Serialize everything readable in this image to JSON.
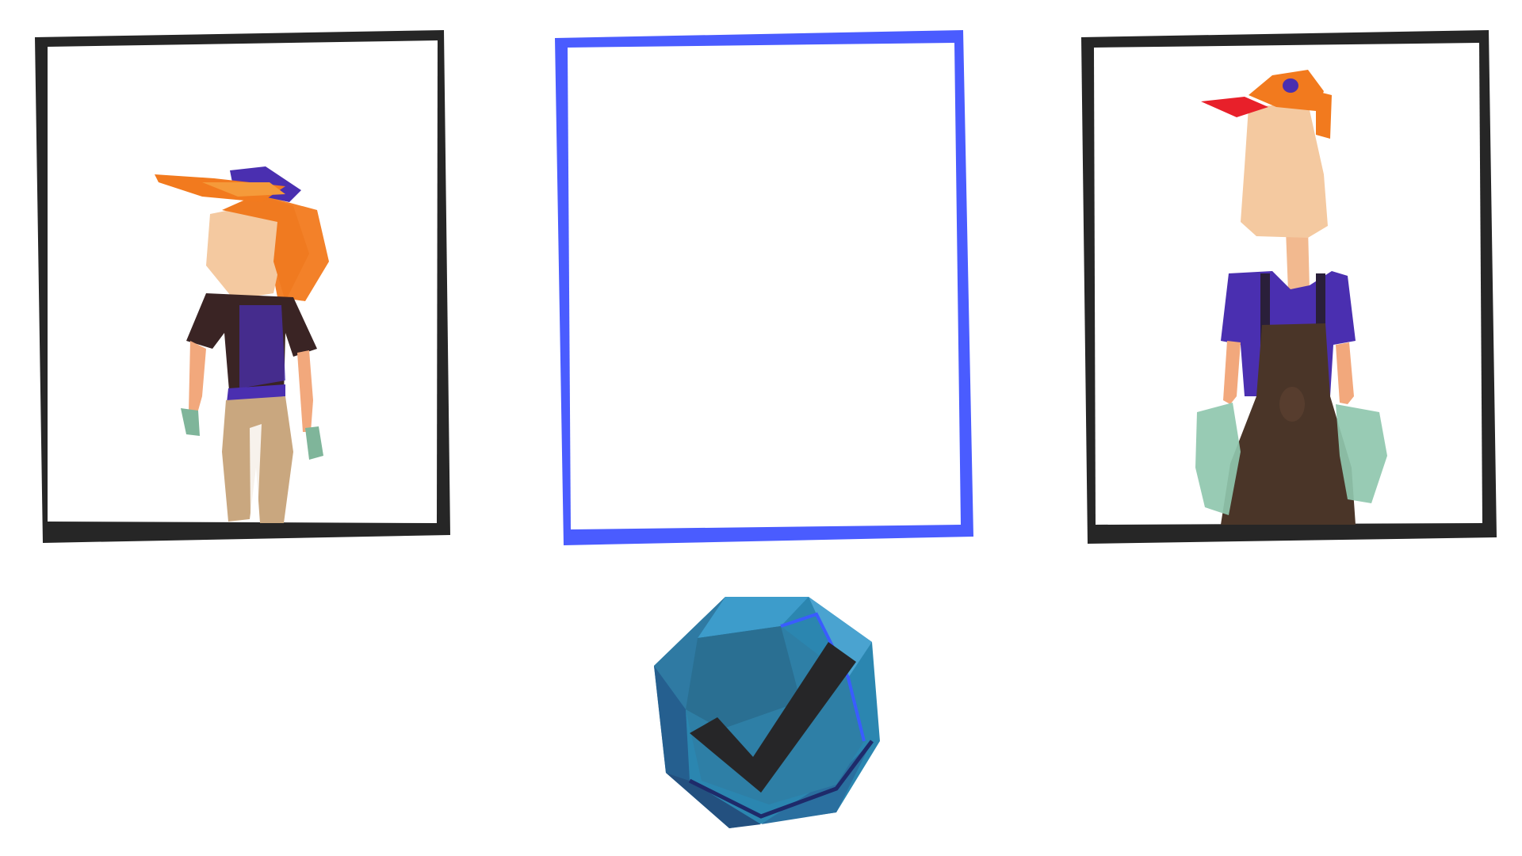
{
  "screen": "character-select",
  "panels": [
    {
      "id": "left",
      "state": "unselected",
      "content": "character-cap-kid",
      "frame_color": "#262626"
    },
    {
      "id": "middle",
      "state": "selected",
      "content": "empty",
      "frame_color": "#4a5cff"
    },
    {
      "id": "right",
      "state": "unselected",
      "content": "character-tall-overalls",
      "frame_color": "#262626"
    }
  ],
  "confirm_button": {
    "icon": "checkmark-icon",
    "color": "#2b86b0"
  },
  "colors": {
    "skin": "#f4c9a0",
    "hair_orange": "#f27a1e",
    "cap_purple": "#4a2fb0",
    "shirt_dark": "#3a2424",
    "pants_tan": "#c9a77f",
    "glove_green": "#7fb59a",
    "overalls_brown": "#4a3528"
  }
}
